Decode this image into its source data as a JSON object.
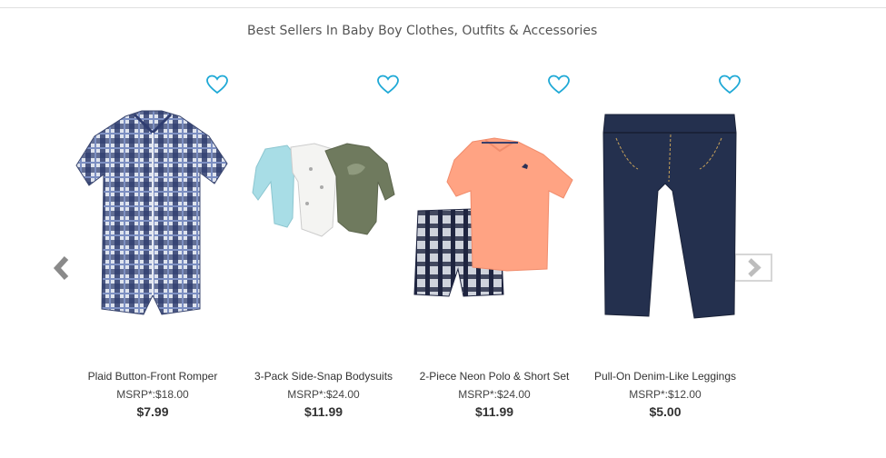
{
  "section": {
    "title": "Best Sellers In Baby Boy Clothes, Outfits & Accessories"
  },
  "carousel": {
    "prev_icon": "chevron-left-icon",
    "next_icon": "chevron-right-icon"
  },
  "products": [
    {
      "name": "Plaid Button-Front Romper",
      "msrp_label": "MSRP*:",
      "msrp": "$18.00",
      "price": "$7.99",
      "icon": "heart-icon"
    },
    {
      "name": "3-Pack Side-Snap Bodysuits",
      "msrp_label": "MSRP*:",
      "msrp": "$24.00",
      "price": "$11.99",
      "icon": "heart-icon"
    },
    {
      "name": "2-Piece Neon Polo & Short Set",
      "msrp_label": "MSRP*:",
      "msrp": "$24.00",
      "price": "$11.99",
      "icon": "heart-icon"
    },
    {
      "name": "Pull-On Denim-Like Leggings",
      "msrp_label": "MSRP*:",
      "msrp": "$12.00",
      "price": "$5.00",
      "icon": "heart-icon"
    }
  ],
  "colors": {
    "heart": "#1fa9d6",
    "arrow": "#888888",
    "text": "#333333"
  }
}
